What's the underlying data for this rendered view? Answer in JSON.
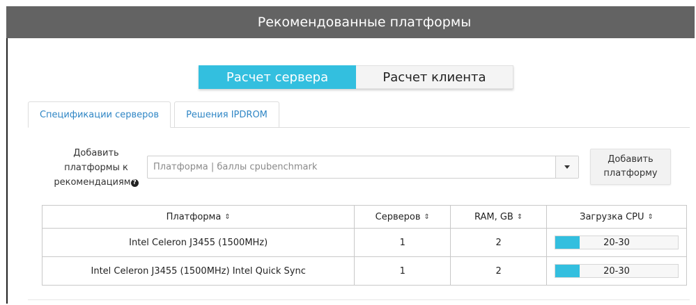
{
  "header": {
    "title": "Рекомендованные платформы"
  },
  "mode_switch": {
    "server_label": "Расчет сервера",
    "client_label": "Расчет клиента",
    "active": "server"
  },
  "tabs": [
    {
      "label": "Спецификации серверов",
      "active": true
    },
    {
      "label": "Решения IPDROM",
      "active": false
    }
  ],
  "add_platform": {
    "label_line1": "Добавить",
    "label_line2": "платформы к",
    "label_line3": "рекомендациям",
    "help_icon": "question-circle-icon",
    "placeholder": "Платформа | баллы cpubenchmark",
    "button_line1": "Добавить",
    "button_line2": "платформу"
  },
  "table": {
    "columns": [
      {
        "label": "Платформа",
        "sort_icon": "sort-icon"
      },
      {
        "label": "Серверов",
        "sort_icon": "sort-icon"
      },
      {
        "label": "RAM, GB",
        "sort_icon": "sort-icon"
      },
      {
        "label": "Загрузка CPU",
        "sort_icon": "sort-icon"
      }
    ],
    "rows": [
      {
        "platform": "Intel Celeron J3455 (1500MHz)",
        "servers": "1",
        "ram": "2",
        "cpu_label": "20-30",
        "cpu_fill": 0.2
      },
      {
        "platform": "Intel Celeron J3455 (1500MHz) Intel Quick Sync",
        "servers": "1",
        "ram": "2",
        "cpu_label": "20-30",
        "cpu_fill": 0.2
      }
    ]
  },
  "colors": {
    "header_bg": "#636363",
    "accent": "#33bfdf",
    "link": "#2f86c5"
  }
}
